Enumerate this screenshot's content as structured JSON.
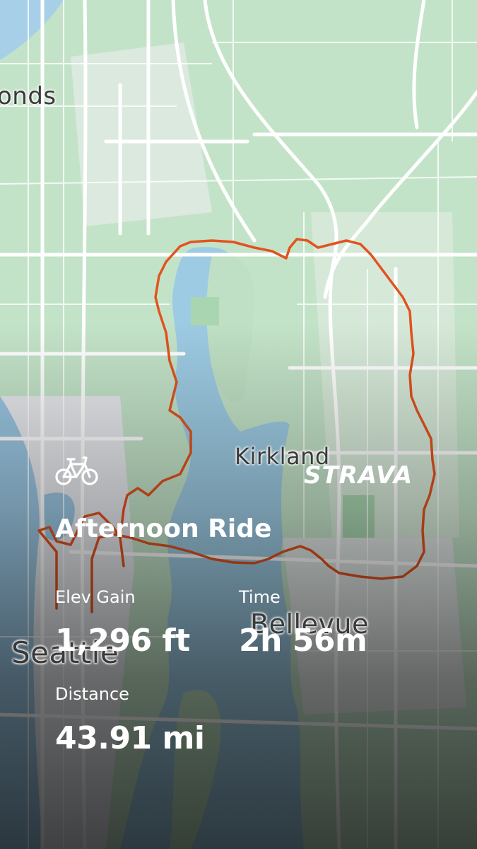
{
  "map": {
    "places": [
      "onds",
      "Kirkland",
      "Bellevue",
      "Seattle"
    ],
    "route_color": "#e2531e"
  },
  "brand": "STRAVA",
  "activity": {
    "icon": "bicycle-icon",
    "title": "Afternoon Ride",
    "stats": {
      "elev_gain": {
        "label": "Elev Gain",
        "value": "1,296 ft"
      },
      "time": {
        "label": "Time",
        "value": "2h 56m"
      },
      "distance": {
        "label": "Distance",
        "value": "43.91 mi"
      }
    }
  }
}
